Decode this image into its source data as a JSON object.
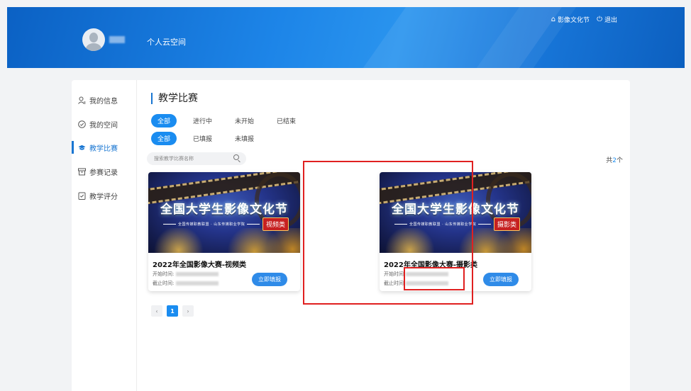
{
  "header": {
    "space_title": "个人云空间",
    "links": [
      {
        "icon": "home-icon",
        "label": "影像文化节"
      },
      {
        "icon": "power-icon",
        "label": "退出"
      }
    ]
  },
  "sidebar": {
    "items": [
      {
        "icon": "user-icon",
        "label": "我的信息"
      },
      {
        "icon": "compass-icon",
        "label": "我的空间"
      },
      {
        "icon": "graduation-cap-icon",
        "label": "教学比赛",
        "active": true
      },
      {
        "icon": "archive-icon",
        "label": "参赛记录"
      },
      {
        "icon": "clipboard-check-icon",
        "label": "教学评分"
      }
    ]
  },
  "main": {
    "title": "教学比赛",
    "status_filters": [
      "全部",
      "进行中",
      "未开始",
      "已结束"
    ],
    "status_selected": "全部",
    "apply_filters": [
      "全部",
      "已填报",
      "未填报"
    ],
    "apply_selected": "全部",
    "search_placeholder": "搜索教学比赛名称",
    "count": {
      "prefix": "共",
      "value": "2",
      "suffix": "个"
    },
    "cards": [
      {
        "banner_title": "全国大学生影像文化节",
        "banner_sub": "全国传媒职教联盟 · 山东传媒职业学院",
        "banner_tag": "视频类",
        "title": "2022年全国影像大赛-视频类",
        "start_label": "开始时间:",
        "end_label": "截止时间:",
        "button": "立即填报"
      },
      {
        "banner_title": "全国大学生影像文化节",
        "banner_sub": "全国传媒职教联盟 · 山东传媒职业学院",
        "banner_tag": "摄影类",
        "title": "2022年全国影像大赛-摄影类",
        "start_label": "开始时间",
        "end_label": "截止时间",
        "button": "立即填报"
      }
    ],
    "pagination": {
      "prev": "‹",
      "current": "1",
      "next": "›"
    }
  },
  "colors": {
    "accent": "#1a8cf0",
    "header": "#1d85e8",
    "highlight": "#e02020"
  }
}
